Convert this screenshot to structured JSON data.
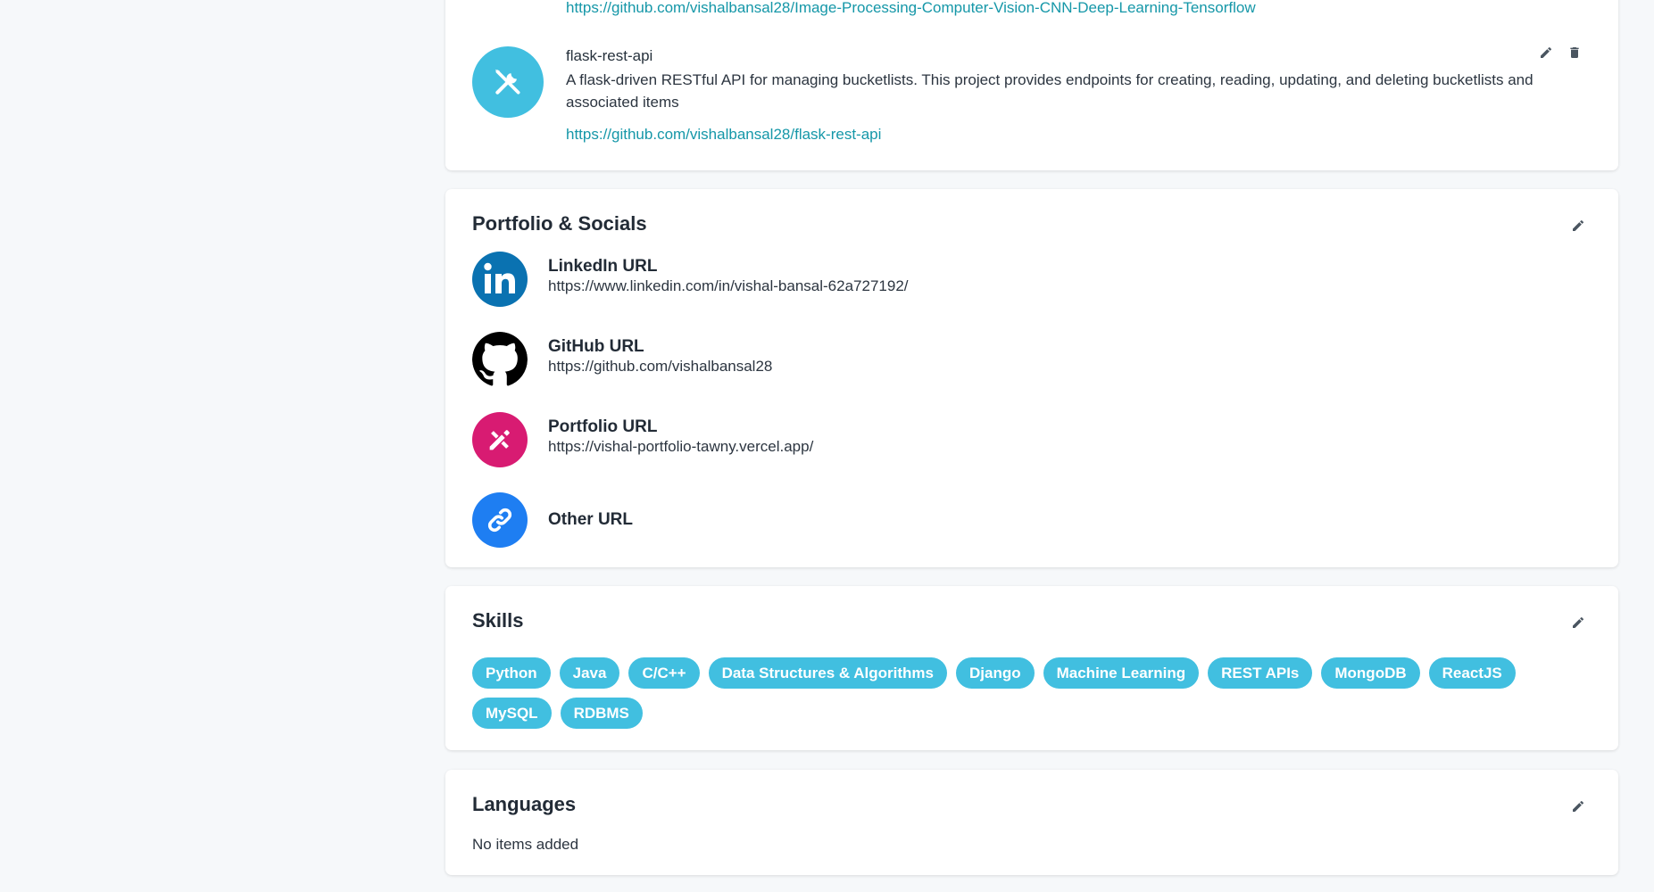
{
  "projects": {
    "previous_link": "https://github.com/vishalbansal28/Image-Processing-Computer-Vision-CNN-Deep-Learning-Tensorflow",
    "item": {
      "name": "flask-rest-api",
      "description": "A flask-driven RESTful API for managing bucketlists. This project provides endpoints for creating, reading, updating, and deleting bucketlists and associated items",
      "link": "https://github.com/vishalbansal28/flask-rest-api",
      "icon": "tools-icon"
    }
  },
  "socials": {
    "title": "Portfolio & Socials",
    "items": [
      {
        "label": "LinkedIn URL",
        "value": "https://www.linkedin.com/in/vishal-bansal-62a727192/",
        "icon": "linkedin-icon",
        "color": "#0a72b1"
      },
      {
        "label": "GitHub URL",
        "value": "https://github.com/vishalbansal28",
        "icon": "github-icon",
        "color": "#000000"
      },
      {
        "label": "Portfolio URL",
        "value": "https://vishal-portfolio-tawny.vercel.app/",
        "icon": "portfolio-icon",
        "color": "#d81b72"
      },
      {
        "label": "Other URL",
        "value": "",
        "icon": "link-icon",
        "color": "#1e7ef2"
      }
    ]
  },
  "skills": {
    "title": "Skills",
    "items": [
      "Python",
      "Java",
      "C/C++",
      "Data Structures & Algorithms",
      "Django",
      "Machine Learning",
      "REST APIs",
      "MongoDB",
      "ReactJS",
      "MySQL",
      "RDBMS"
    ]
  },
  "languages": {
    "title": "Languages",
    "empty_text": "No items added"
  },
  "colors": {
    "accent": "#41bfe0",
    "link": "#1597a8",
    "background": "#f6f8fa"
  }
}
